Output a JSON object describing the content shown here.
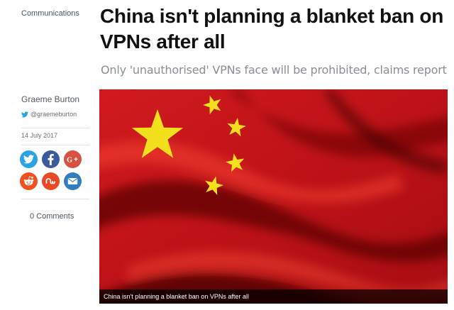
{
  "article": {
    "category": "Communications",
    "headline": "China isn't planning a blanket ban on VPNs after all",
    "subtitle": "Only 'unauthorised' VPNs face will be prohibited, claims report"
  },
  "byline": {
    "author": "Graeme Burton",
    "twitter_handle": "@graemeburton",
    "date": "14 July 2017"
  },
  "share": {
    "buttons": [
      {
        "network": "twitter",
        "icon": "twitter-icon",
        "color": "#2aa3e6"
      },
      {
        "network": "facebook",
        "icon": "facebook-icon",
        "color": "#3b5a9b"
      },
      {
        "network": "google-plus",
        "icon": "google-plus-icon",
        "color": "#d8503f"
      },
      {
        "network": "reddit",
        "icon": "reddit-icon",
        "color": "#f2501d"
      },
      {
        "network": "stumbleupon",
        "icon": "stumbleupon-icon",
        "color": "#ec4823"
      },
      {
        "network": "email",
        "icon": "email-icon",
        "color": "#2f7ec1"
      }
    ]
  },
  "comments": {
    "label": "0 Comments"
  },
  "hero": {
    "image": "china-flag-image",
    "caption": "China isn't planning a blanket ban on VPNs after all",
    "colors": {
      "flag_red": "#c8141b",
      "star_yellow": "#f2e01d"
    }
  }
}
